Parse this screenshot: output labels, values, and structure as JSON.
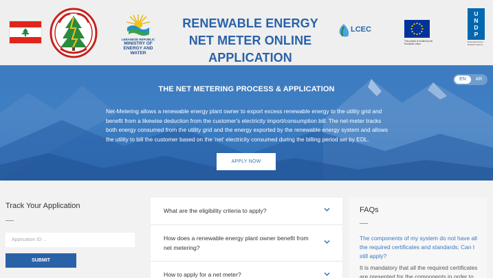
{
  "header": {
    "ministry_line1": "LEBANESE REPUBLIC",
    "ministry_line2": "MINISTRY OF ENERGY AND WATER",
    "title": "RENEWABLE ENERGY NET METER ONLINE APPLICATION",
    "lcec_label": "LCEC",
    "eu_caption": "This project is funded by the European Union",
    "undp_label": "UNDP",
    "undp_caption": "Empowered lives. Resilient nations."
  },
  "hero": {
    "lang_en": "EN",
    "lang_ar": "AR",
    "title": "THE NET METERING PROCESS & APPLICATION",
    "text": "Net-Metering allows a renewable energy plant owner to export excess renewable energy to the utility grid and benefit from a likewise deduction from the customer's electricity import/consumption bill. The net-meter tracks both energy consumed from the utility grid and the energy exported by the renewable energy system and allows the utility to bill the customer based on the 'net' electricity consumed during the billing period set by EDL.",
    "apply_label": "APPLY NOW"
  },
  "track": {
    "title": "Track Your Application",
    "placeholder": "Application ID ...",
    "submit_label": "SUBMIT"
  },
  "faq_list": {
    "items": [
      {
        "question": "What are the eligibility criteria to apply?"
      },
      {
        "question": "How does a renewable energy plant owner benefit from net metering?"
      },
      {
        "question": "How to apply for a net meter?"
      }
    ]
  },
  "faqs": {
    "title": "FAQs",
    "question": "The components of my system do not have all the required certificates and standards; Can I still apply?",
    "answer": "It is mandatory that all the required certificates are presented for the components in order to"
  },
  "colors": {
    "brand_blue": "#2a62a8",
    "hero_blue": "#3d7bc0",
    "flag_red": "#e1251b",
    "eu_blue": "#003399",
    "undp_blue": "#0468b1"
  },
  "icons": [
    "cedar-icon",
    "edl-logo",
    "ministry-logo",
    "lcec-logo",
    "eu-stars-icon",
    "undp-logo",
    "chevron-down-icon"
  ]
}
